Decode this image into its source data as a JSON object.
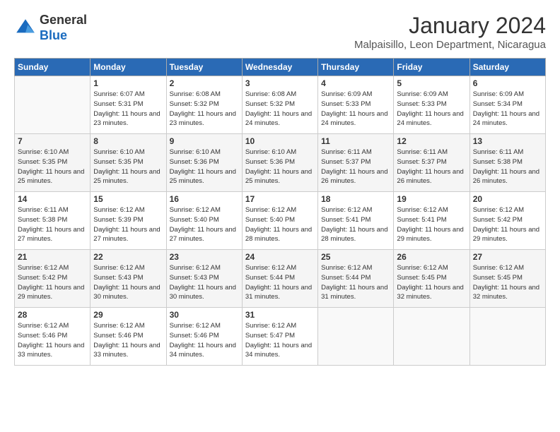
{
  "header": {
    "logo_general": "General",
    "logo_blue": "Blue",
    "month_year": "January 2024",
    "location": "Malpaisillo, Leon Department, Nicaragua"
  },
  "days_of_week": [
    "Sunday",
    "Monday",
    "Tuesday",
    "Wednesday",
    "Thursday",
    "Friday",
    "Saturday"
  ],
  "weeks": [
    [
      {
        "day": "",
        "empty": true
      },
      {
        "day": "1",
        "sunrise": "6:07 AM",
        "sunset": "5:31 PM",
        "daylight": "11 hours and 23 minutes."
      },
      {
        "day": "2",
        "sunrise": "6:08 AM",
        "sunset": "5:32 PM",
        "daylight": "11 hours and 23 minutes."
      },
      {
        "day": "3",
        "sunrise": "6:08 AM",
        "sunset": "5:32 PM",
        "daylight": "11 hours and 24 minutes."
      },
      {
        "day": "4",
        "sunrise": "6:09 AM",
        "sunset": "5:33 PM",
        "daylight": "11 hours and 24 minutes."
      },
      {
        "day": "5",
        "sunrise": "6:09 AM",
        "sunset": "5:33 PM",
        "daylight": "11 hours and 24 minutes."
      },
      {
        "day": "6",
        "sunrise": "6:09 AM",
        "sunset": "5:34 PM",
        "daylight": "11 hours and 24 minutes."
      }
    ],
    [
      {
        "day": "7",
        "sunrise": "6:10 AM",
        "sunset": "5:35 PM",
        "daylight": "11 hours and 25 minutes."
      },
      {
        "day": "8",
        "sunrise": "6:10 AM",
        "sunset": "5:35 PM",
        "daylight": "11 hours and 25 minutes."
      },
      {
        "day": "9",
        "sunrise": "6:10 AM",
        "sunset": "5:36 PM",
        "daylight": "11 hours and 25 minutes."
      },
      {
        "day": "10",
        "sunrise": "6:10 AM",
        "sunset": "5:36 PM",
        "daylight": "11 hours and 25 minutes."
      },
      {
        "day": "11",
        "sunrise": "6:11 AM",
        "sunset": "5:37 PM",
        "daylight": "11 hours and 26 minutes."
      },
      {
        "day": "12",
        "sunrise": "6:11 AM",
        "sunset": "5:37 PM",
        "daylight": "11 hours and 26 minutes."
      },
      {
        "day": "13",
        "sunrise": "6:11 AM",
        "sunset": "5:38 PM",
        "daylight": "11 hours and 26 minutes."
      }
    ],
    [
      {
        "day": "14",
        "sunrise": "6:11 AM",
        "sunset": "5:38 PM",
        "daylight": "11 hours and 27 minutes."
      },
      {
        "day": "15",
        "sunrise": "6:12 AM",
        "sunset": "5:39 PM",
        "daylight": "11 hours and 27 minutes."
      },
      {
        "day": "16",
        "sunrise": "6:12 AM",
        "sunset": "5:40 PM",
        "daylight": "11 hours and 27 minutes."
      },
      {
        "day": "17",
        "sunrise": "6:12 AM",
        "sunset": "5:40 PM",
        "daylight": "11 hours and 28 minutes."
      },
      {
        "day": "18",
        "sunrise": "6:12 AM",
        "sunset": "5:41 PM",
        "daylight": "11 hours and 28 minutes."
      },
      {
        "day": "19",
        "sunrise": "6:12 AM",
        "sunset": "5:41 PM",
        "daylight": "11 hours and 29 minutes."
      },
      {
        "day": "20",
        "sunrise": "6:12 AM",
        "sunset": "5:42 PM",
        "daylight": "11 hours and 29 minutes."
      }
    ],
    [
      {
        "day": "21",
        "sunrise": "6:12 AM",
        "sunset": "5:42 PM",
        "daylight": "11 hours and 29 minutes."
      },
      {
        "day": "22",
        "sunrise": "6:12 AM",
        "sunset": "5:43 PM",
        "daylight": "11 hours and 30 minutes."
      },
      {
        "day": "23",
        "sunrise": "6:12 AM",
        "sunset": "5:43 PM",
        "daylight": "11 hours and 30 minutes."
      },
      {
        "day": "24",
        "sunrise": "6:12 AM",
        "sunset": "5:44 PM",
        "daylight": "11 hours and 31 minutes."
      },
      {
        "day": "25",
        "sunrise": "6:12 AM",
        "sunset": "5:44 PM",
        "daylight": "11 hours and 31 minutes."
      },
      {
        "day": "26",
        "sunrise": "6:12 AM",
        "sunset": "5:45 PM",
        "daylight": "11 hours and 32 minutes."
      },
      {
        "day": "27",
        "sunrise": "6:12 AM",
        "sunset": "5:45 PM",
        "daylight": "11 hours and 32 minutes."
      }
    ],
    [
      {
        "day": "28",
        "sunrise": "6:12 AM",
        "sunset": "5:46 PM",
        "daylight": "11 hours and 33 minutes."
      },
      {
        "day": "29",
        "sunrise": "6:12 AM",
        "sunset": "5:46 PM",
        "daylight": "11 hours and 33 minutes."
      },
      {
        "day": "30",
        "sunrise": "6:12 AM",
        "sunset": "5:46 PM",
        "daylight": "11 hours and 34 minutes."
      },
      {
        "day": "31",
        "sunrise": "6:12 AM",
        "sunset": "5:47 PM",
        "daylight": "11 hours and 34 minutes."
      },
      {
        "day": "",
        "empty": true
      },
      {
        "day": "",
        "empty": true
      },
      {
        "day": "",
        "empty": true
      }
    ]
  ]
}
